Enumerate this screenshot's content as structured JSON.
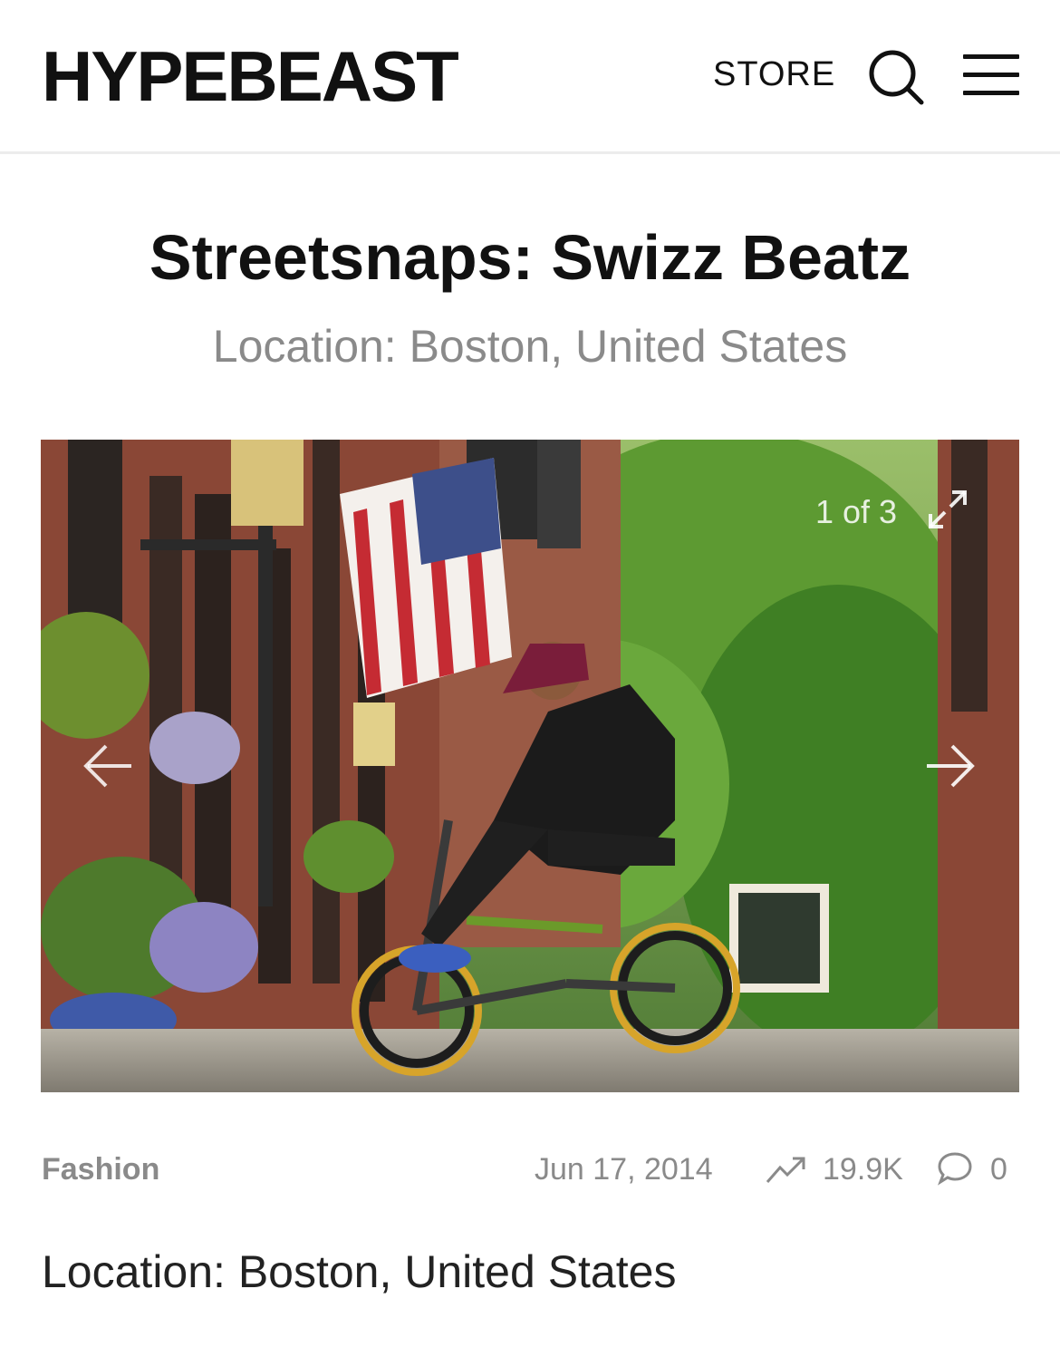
{
  "header": {
    "logo": "HYPEBEAST",
    "store_label": "STORE",
    "search_icon": "search-icon",
    "menu_icon": "hamburger-menu-icon"
  },
  "article": {
    "title": "Streetsnaps: Swizz Beatz",
    "subtitle": "Location: Boston, United States",
    "category": "Fashion",
    "date": "Jun 17, 2014",
    "views": "19.9K",
    "comments": "0",
    "body": "Location: Boston, United States"
  },
  "gallery": {
    "counter": "1 of 3",
    "image_description_icon": "photo",
    "prev_icon": "arrow-left-icon",
    "next_icon": "arrow-right-icon",
    "expand_icon": "expand-icon"
  },
  "colors": {
    "text": "#111111",
    "muted": "#8a8a8a",
    "divider": "#ececec"
  }
}
